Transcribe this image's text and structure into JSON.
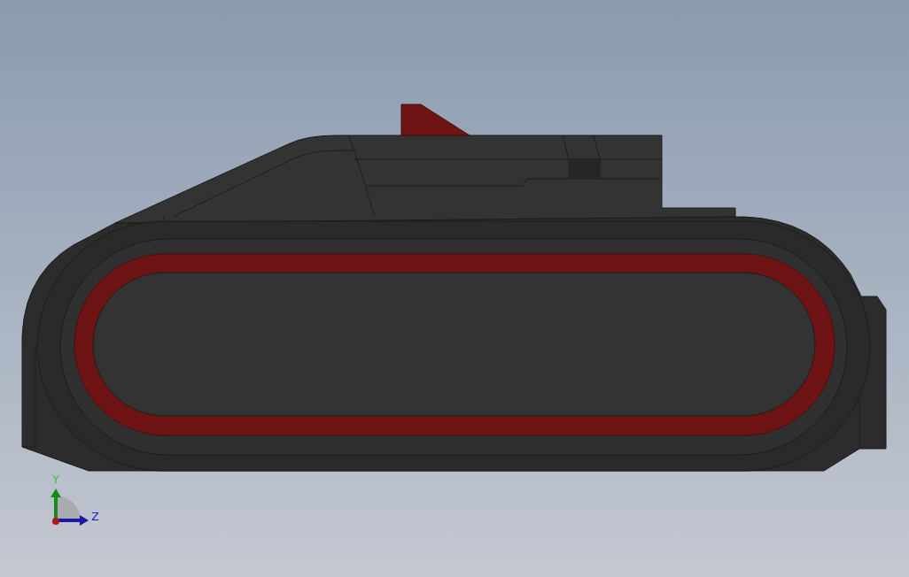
{
  "viewport": {
    "triad": {
      "axes": [
        {
          "kind": "y",
          "label": "Y"
        },
        {
          "kind": "z",
          "label": "Z"
        }
      ]
    }
  }
}
